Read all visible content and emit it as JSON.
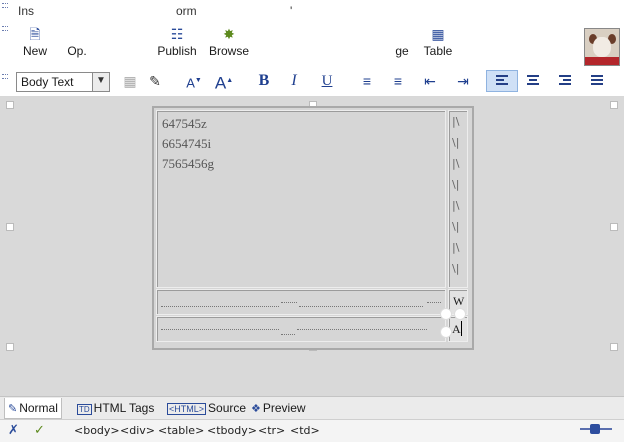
{
  "menu": {
    "fragments": [
      "Ins",
      "orm",
      "'"
    ]
  },
  "toolbar": {
    "buttons": [
      {
        "label": "New",
        "icon": "new-page-icon"
      },
      {
        "label": "Op.",
        "icon": "open-icon"
      },
      {
        "label": "Publish",
        "icon": "publish-icon"
      },
      {
        "label": "Browse",
        "icon": "browse-icon"
      },
      {
        "label": "ge",
        "icon": "image-icon"
      },
      {
        "label": "Table",
        "icon": "table-icon"
      }
    ]
  },
  "format": {
    "style_value": "Body Text",
    "buttons": [
      "B",
      "I",
      "U"
    ],
    "active_button": "align-left"
  },
  "document": {
    "lines": [
      "647545z",
      "6654745i",
      "7565456g"
    ],
    "right_col_marks": [
      "|\\",
      "\\|",
      "|\\",
      "\\|",
      "|\\",
      "\\|",
      "|\\",
      "\\|"
    ],
    "row2_cell": "W",
    "row3_cell": "A"
  },
  "tabs": [
    {
      "label": "Normal",
      "icon": "pen-icon",
      "active": true
    },
    {
      "label": "HTML Tags",
      "icon": "td-tag-icon",
      "active": false
    },
    {
      "label": "Source",
      "icon": "html-source-icon",
      "active": false
    },
    {
      "label": "Preview",
      "icon": "preview-icon",
      "active": false
    }
  ],
  "tag_selector": [
    "<body>",
    "<div>",
    "<table>",
    "<tbody>",
    "<tr>",
    "<td>"
  ],
  "colors": {
    "accent": "#2a4b9a",
    "canvas": "#d9d9d9",
    "active_bg": "#cfe0f6"
  }
}
